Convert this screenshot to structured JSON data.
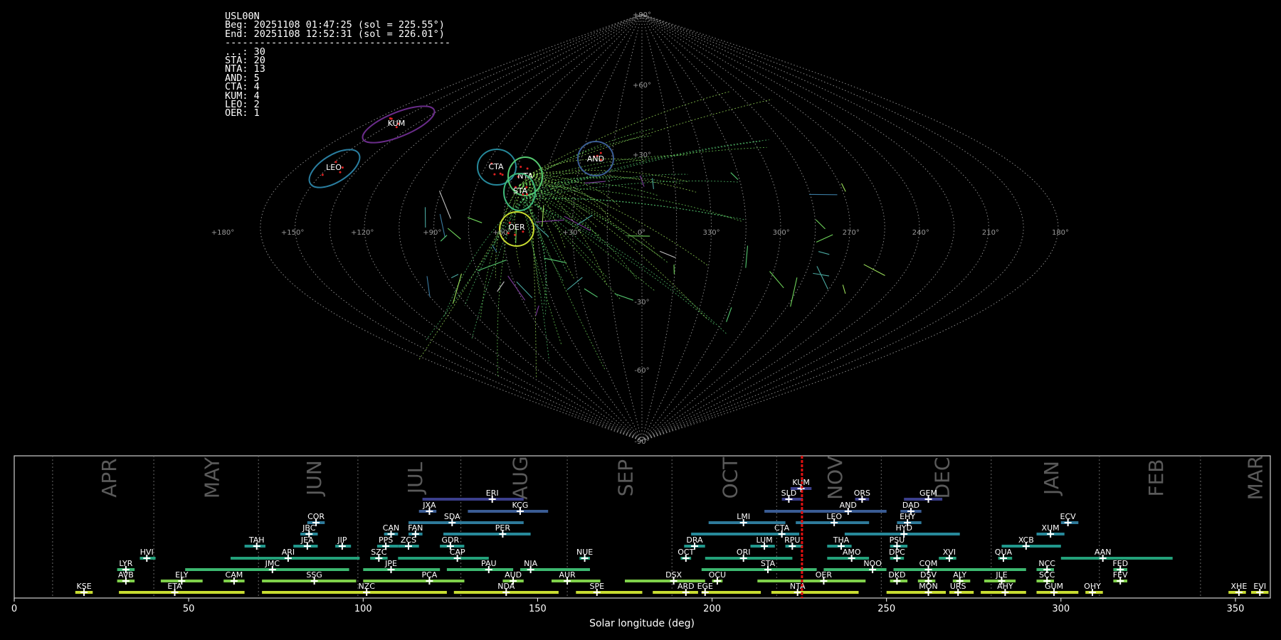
{
  "stats_panel": {
    "lines": [
      "USL00N",
      "Beg: 20251108 01:47:25 (sol = 225.55°)",
      "End: 20251108 12:52:31 (sol = 226.01°)",
      "---------------------------------------",
      "...: 30",
      "STA: 20",
      "NTA: 13",
      "AND: 5",
      "CTA: 4",
      "KUM: 4",
      "LEO: 2",
      "OER: 1"
    ]
  },
  "sky_map": {
    "projection": "sinusoidal",
    "lon_tick_labels": [
      "+180°",
      "+150°",
      "+120°",
      "+90°",
      "+60°",
      "+30°",
      "0°",
      "330°",
      "300°",
      "270°",
      "240°",
      "210°",
      "180°"
    ],
    "lat_tick_labels": [
      "+90°",
      "+60°",
      "+30°",
      "0°",
      "-30°",
      "-60°",
      "-90°"
    ],
    "shower_circles": [
      {
        "code": "KUM",
        "color": "#6a2c8a"
      },
      {
        "code": "LEO",
        "color": "#2a7ea0"
      },
      {
        "code": "CTA",
        "color": "#26889a"
      },
      {
        "code": "AND",
        "color": "#3a5c94"
      },
      {
        "code": "NTA",
        "color": "#55c870"
      },
      {
        "code": "STA",
        "color": "#3fb87a"
      },
      {
        "code": "OER",
        "color": "#c8dc30"
      }
    ]
  },
  "chart_data": {
    "type": "timeline",
    "xlabel": "Solar longitude (deg)",
    "xlim": [
      0,
      360
    ],
    "x_ticks": [
      0,
      50,
      100,
      150,
      200,
      250,
      300,
      350
    ],
    "months": [
      "APR",
      "MAY",
      "JUN",
      "JUL",
      "AUG",
      "SEP",
      "OCT",
      "NOV",
      "DEC",
      "JAN",
      "FEB",
      "MAR"
    ],
    "current_sol": 225.78,
    "showers": [
      {
        "code": "KUM",
        "start": 222.5,
        "end": 228.5,
        "peak": 225.5,
        "color": "#3b3f8c"
      },
      {
        "code": "ERI",
        "start": 117,
        "end": 146,
        "peak": 137,
        "color": "#3b3f8c"
      },
      {
        "code": "SLD",
        "start": 220,
        "end": 226,
        "peak": 222,
        "color": "#3b3f8c"
      },
      {
        "code": "ORS",
        "start": 241,
        "end": 245,
        "peak": 243,
        "color": "#3b3f8c"
      },
      {
        "code": "GEM",
        "start": 255,
        "end": 266,
        "peak": 262,
        "color": "#3b3f8c"
      },
      {
        "code": "JXA",
        "start": 116,
        "end": 121,
        "peak": 119,
        "color": "#3a5c94"
      },
      {
        "code": "KCG",
        "start": 130,
        "end": 153,
        "peak": 145,
        "color": "#3a5c94"
      },
      {
        "code": "AND",
        "start": 215,
        "end": 250,
        "peak": 239,
        "color": "#3a5c94"
      },
      {
        "code": "DAD",
        "start": 254,
        "end": 260,
        "peak": 257,
        "color": "#3a5c94"
      },
      {
        "code": "COR",
        "start": 84,
        "end": 89,
        "peak": 86.5,
        "color": "#2e7a9a"
      },
      {
        "code": "SDA",
        "start": 113,
        "end": 146,
        "peak": 125.5,
        "color": "#2e7a9a"
      },
      {
        "code": "LMI",
        "start": 199,
        "end": 221,
        "peak": 209,
        "color": "#2e7a9a"
      },
      {
        "code": "LEO",
        "start": 224,
        "end": 245,
        "peak": 235,
        "color": "#2e7a9a"
      },
      {
        "code": "EHY",
        "start": 253,
        "end": 260,
        "peak": 256,
        "color": "#2e7a9a"
      },
      {
        "code": "ECV",
        "start": 300,
        "end": 305,
        "peak": 302,
        "color": "#2e7a9a"
      },
      {
        "code": "JBC",
        "start": 82,
        "end": 87,
        "peak": 84.5,
        "color": "#27899a"
      },
      {
        "code": "CAN",
        "start": 106,
        "end": 110,
        "peak": 108,
        "color": "#27899a"
      },
      {
        "code": "FAN",
        "start": 113,
        "end": 117,
        "peak": 115,
        "color": "#27899a"
      },
      {
        "code": "PER",
        "start": 123,
        "end": 148,
        "peak": 140,
        "color": "#27899a"
      },
      {
        "code": "CTA",
        "start": 194,
        "end": 225,
        "peak": 220,
        "color": "#27899a"
      },
      {
        "code": "HYD",
        "start": 238,
        "end": 271,
        "peak": 255,
        "color": "#27899a"
      },
      {
        "code": "XUM",
        "start": 293,
        "end": 301,
        "peak": 297,
        "color": "#27899a"
      },
      {
        "code": "TAH",
        "start": 66,
        "end": 72,
        "peak": 69.5,
        "color": "#21978c"
      },
      {
        "code": "JEA",
        "start": 80,
        "end": 87,
        "peak": 84,
        "color": "#21978c"
      },
      {
        "code": "JIP",
        "start": 92,
        "end": 96.5,
        "peak": 94,
        "color": "#21978c"
      },
      {
        "code": "PPS",
        "start": 104,
        "end": 110,
        "peak": 106.5,
        "color": "#21978c"
      },
      {
        "code": "ZCS",
        "start": 110,
        "end": 116,
        "peak": 113,
        "color": "#21978c"
      },
      {
        "code": "GDR",
        "start": 122,
        "end": 129,
        "peak": 125,
        "color": "#21978c"
      },
      {
        "code": "DRA",
        "start": 192,
        "end": 198,
        "peak": 195,
        "color": "#21978c"
      },
      {
        "code": "LUM",
        "start": 211,
        "end": 218,
        "peak": 215,
        "color": "#21978c"
      },
      {
        "code": "RPU",
        "start": 221,
        "end": 226,
        "peak": 223,
        "color": "#21978c"
      },
      {
        "code": "THA",
        "start": 233,
        "end": 240,
        "peak": 237,
        "color": "#21978c"
      },
      {
        "code": "PSU",
        "start": 251,
        "end": 256,
        "peak": 253,
        "color": "#21978c"
      },
      {
        "code": "XCB",
        "start": 283,
        "end": 300,
        "peak": 290,
        "color": "#21978c"
      },
      {
        "code": "HVI",
        "start": 36,
        "end": 40.5,
        "peak": 38,
        "color": "#23a17a"
      },
      {
        "code": "ARI",
        "start": 62,
        "end": 99,
        "peak": 78.5,
        "color": "#23a17a"
      },
      {
        "code": "SZC",
        "start": 102,
        "end": 107,
        "peak": 104.5,
        "color": "#23a17a"
      },
      {
        "code": "CAP",
        "start": 110,
        "end": 136,
        "peak": 127,
        "color": "#23a17a"
      },
      {
        "code": "NUE",
        "start": 162,
        "end": 165,
        "peak": 163.5,
        "color": "#23a17a"
      },
      {
        "code": "OCT",
        "start": 191,
        "end": 194,
        "peak": 192.5,
        "color": "#23a17a"
      },
      {
        "code": "ORI",
        "start": 198,
        "end": 223,
        "peak": 209,
        "color": "#23a17a"
      },
      {
        "code": "AMO",
        "start": 233,
        "end": 245,
        "peak": 240,
        "color": "#23a17a"
      },
      {
        "code": "DPC",
        "start": 251,
        "end": 255,
        "peak": 253,
        "color": "#23a17a"
      },
      {
        "code": "XVI",
        "start": 265,
        "end": 270,
        "peak": 268,
        "color": "#23a17a"
      },
      {
        "code": "QUA",
        "start": 282,
        "end": 286,
        "peak": 283.5,
        "color": "#23a17a"
      },
      {
        "code": "AAN",
        "start": 300,
        "end": 332,
        "peak": 312,
        "color": "#23a17a"
      },
      {
        "code": "LYR",
        "start": 29.5,
        "end": 34.5,
        "peak": 32,
        "color": "#3cb870"
      },
      {
        "code": "JMC",
        "start": 49,
        "end": 96,
        "peak": 74,
        "color": "#3cb870"
      },
      {
        "code": "JPE",
        "start": 100,
        "end": 122,
        "peak": 108,
        "color": "#3cb870"
      },
      {
        "code": "PAU",
        "start": 124,
        "end": 143,
        "peak": 136,
        "color": "#3cb870"
      },
      {
        "code": "NIA",
        "start": 145,
        "end": 165,
        "peak": 148,
        "color": "#3cb870"
      },
      {
        "code": "STA",
        "start": 197,
        "end": 230,
        "peak": 216,
        "color": "#3cb870"
      },
      {
        "code": "NOO",
        "start": 232,
        "end": 250,
        "peak": 246,
        "color": "#3cb870"
      },
      {
        "code": "COM",
        "start": 252,
        "end": 290,
        "peak": 262,
        "color": "#3cb870"
      },
      {
        "code": "NCC",
        "start": 293,
        "end": 298,
        "peak": 296,
        "color": "#3cb870"
      },
      {
        "code": "FED",
        "start": 315,
        "end": 319,
        "peak": 317,
        "color": "#3cb870"
      },
      {
        "code": "AVB",
        "start": 29.5,
        "end": 34.5,
        "peak": 32,
        "color": "#7fd04a"
      },
      {
        "code": "ELY",
        "start": 42,
        "end": 54,
        "peak": 48,
        "color": "#7fd04a"
      },
      {
        "code": "CAM",
        "start": 60,
        "end": 66,
        "peak": 63,
        "color": "#7fd04a"
      },
      {
        "code": "SSG",
        "start": 71,
        "end": 98,
        "peak": 86,
        "color": "#7fd04a"
      },
      {
        "code": "PCA",
        "start": 100,
        "end": 129,
        "peak": 119,
        "color": "#7fd04a"
      },
      {
        "code": "AUD",
        "start": 140,
        "end": 146,
        "peak": 143,
        "color": "#7fd04a"
      },
      {
        "code": "AUR",
        "start": 154,
        "end": 168,
        "peak": 158.5,
        "color": "#7fd04a"
      },
      {
        "code": "DSX",
        "start": 175,
        "end": 198,
        "peak": 189,
        "color": "#7fd04a"
      },
      {
        "code": "OCU",
        "start": 200,
        "end": 203,
        "peak": 201.5,
        "color": "#7fd04a"
      },
      {
        "code": "OER",
        "start": 213,
        "end": 244,
        "peak": 232,
        "color": "#7fd04a"
      },
      {
        "code": "DKD",
        "start": 251,
        "end": 256,
        "peak": 253,
        "color": "#7fd04a"
      },
      {
        "code": "DSV",
        "start": 259,
        "end": 264,
        "peak": 262,
        "color": "#7fd04a"
      },
      {
        "code": "ALY",
        "start": 269,
        "end": 274,
        "peak": 271,
        "color": "#7fd04a"
      },
      {
        "code": "JLE",
        "start": 278,
        "end": 287,
        "peak": 283,
        "color": "#7fd04a"
      },
      {
        "code": "SCC",
        "start": 293,
        "end": 298,
        "peak": 296,
        "color": "#7fd04a"
      },
      {
        "code": "FEV",
        "start": 315,
        "end": 319,
        "peak": 317,
        "color": "#7fd04a"
      },
      {
        "code": "KSE",
        "start": 17.5,
        "end": 22.5,
        "peak": 20,
        "color": "#c8dc30"
      },
      {
        "code": "ETA",
        "start": 30,
        "end": 66,
        "peak": 46,
        "color": "#c8dc30"
      },
      {
        "code": "NZC",
        "start": 71,
        "end": 124,
        "peak": 101,
        "color": "#c8dc30"
      },
      {
        "code": "NDA",
        "start": 126,
        "end": 156,
        "peak": 141,
        "color": "#c8dc30"
      },
      {
        "code": "SPE",
        "start": 161,
        "end": 180,
        "peak": 167,
        "color": "#c8dc30"
      },
      {
        "code": "ARD",
        "start": 183,
        "end": 196,
        "peak": 192.5,
        "color": "#c8dc30"
      },
      {
        "code": "EGE",
        "start": 197,
        "end": 214,
        "peak": 198,
        "color": "#c8dc30"
      },
      {
        "code": "NTA",
        "start": 217,
        "end": 242,
        "peak": 224.5,
        "color": "#c8dc30"
      },
      {
        "code": "MON",
        "start": 250,
        "end": 267,
        "peak": 262,
        "color": "#c8dc30"
      },
      {
        "code": "URS",
        "start": 268,
        "end": 275,
        "peak": 270.5,
        "color": "#c8dc30"
      },
      {
        "code": "AHY",
        "start": 277,
        "end": 290,
        "peak": 284,
        "color": "#c8dc30"
      },
      {
        "code": "GUM",
        "start": 293,
        "end": 305,
        "peak": 298,
        "color": "#c8dc30"
      },
      {
        "code": "OHY",
        "start": 307,
        "end": 312,
        "peak": 309,
        "color": "#c8dc30"
      },
      {
        "code": "XHE",
        "start": 348,
        "end": 353,
        "peak": 351,
        "color": "#c8dc30"
      },
      {
        "code": "EVI",
        "start": 354.5,
        "end": 359.5,
        "peak": 357,
        "color": "#c8dc30"
      }
    ]
  }
}
